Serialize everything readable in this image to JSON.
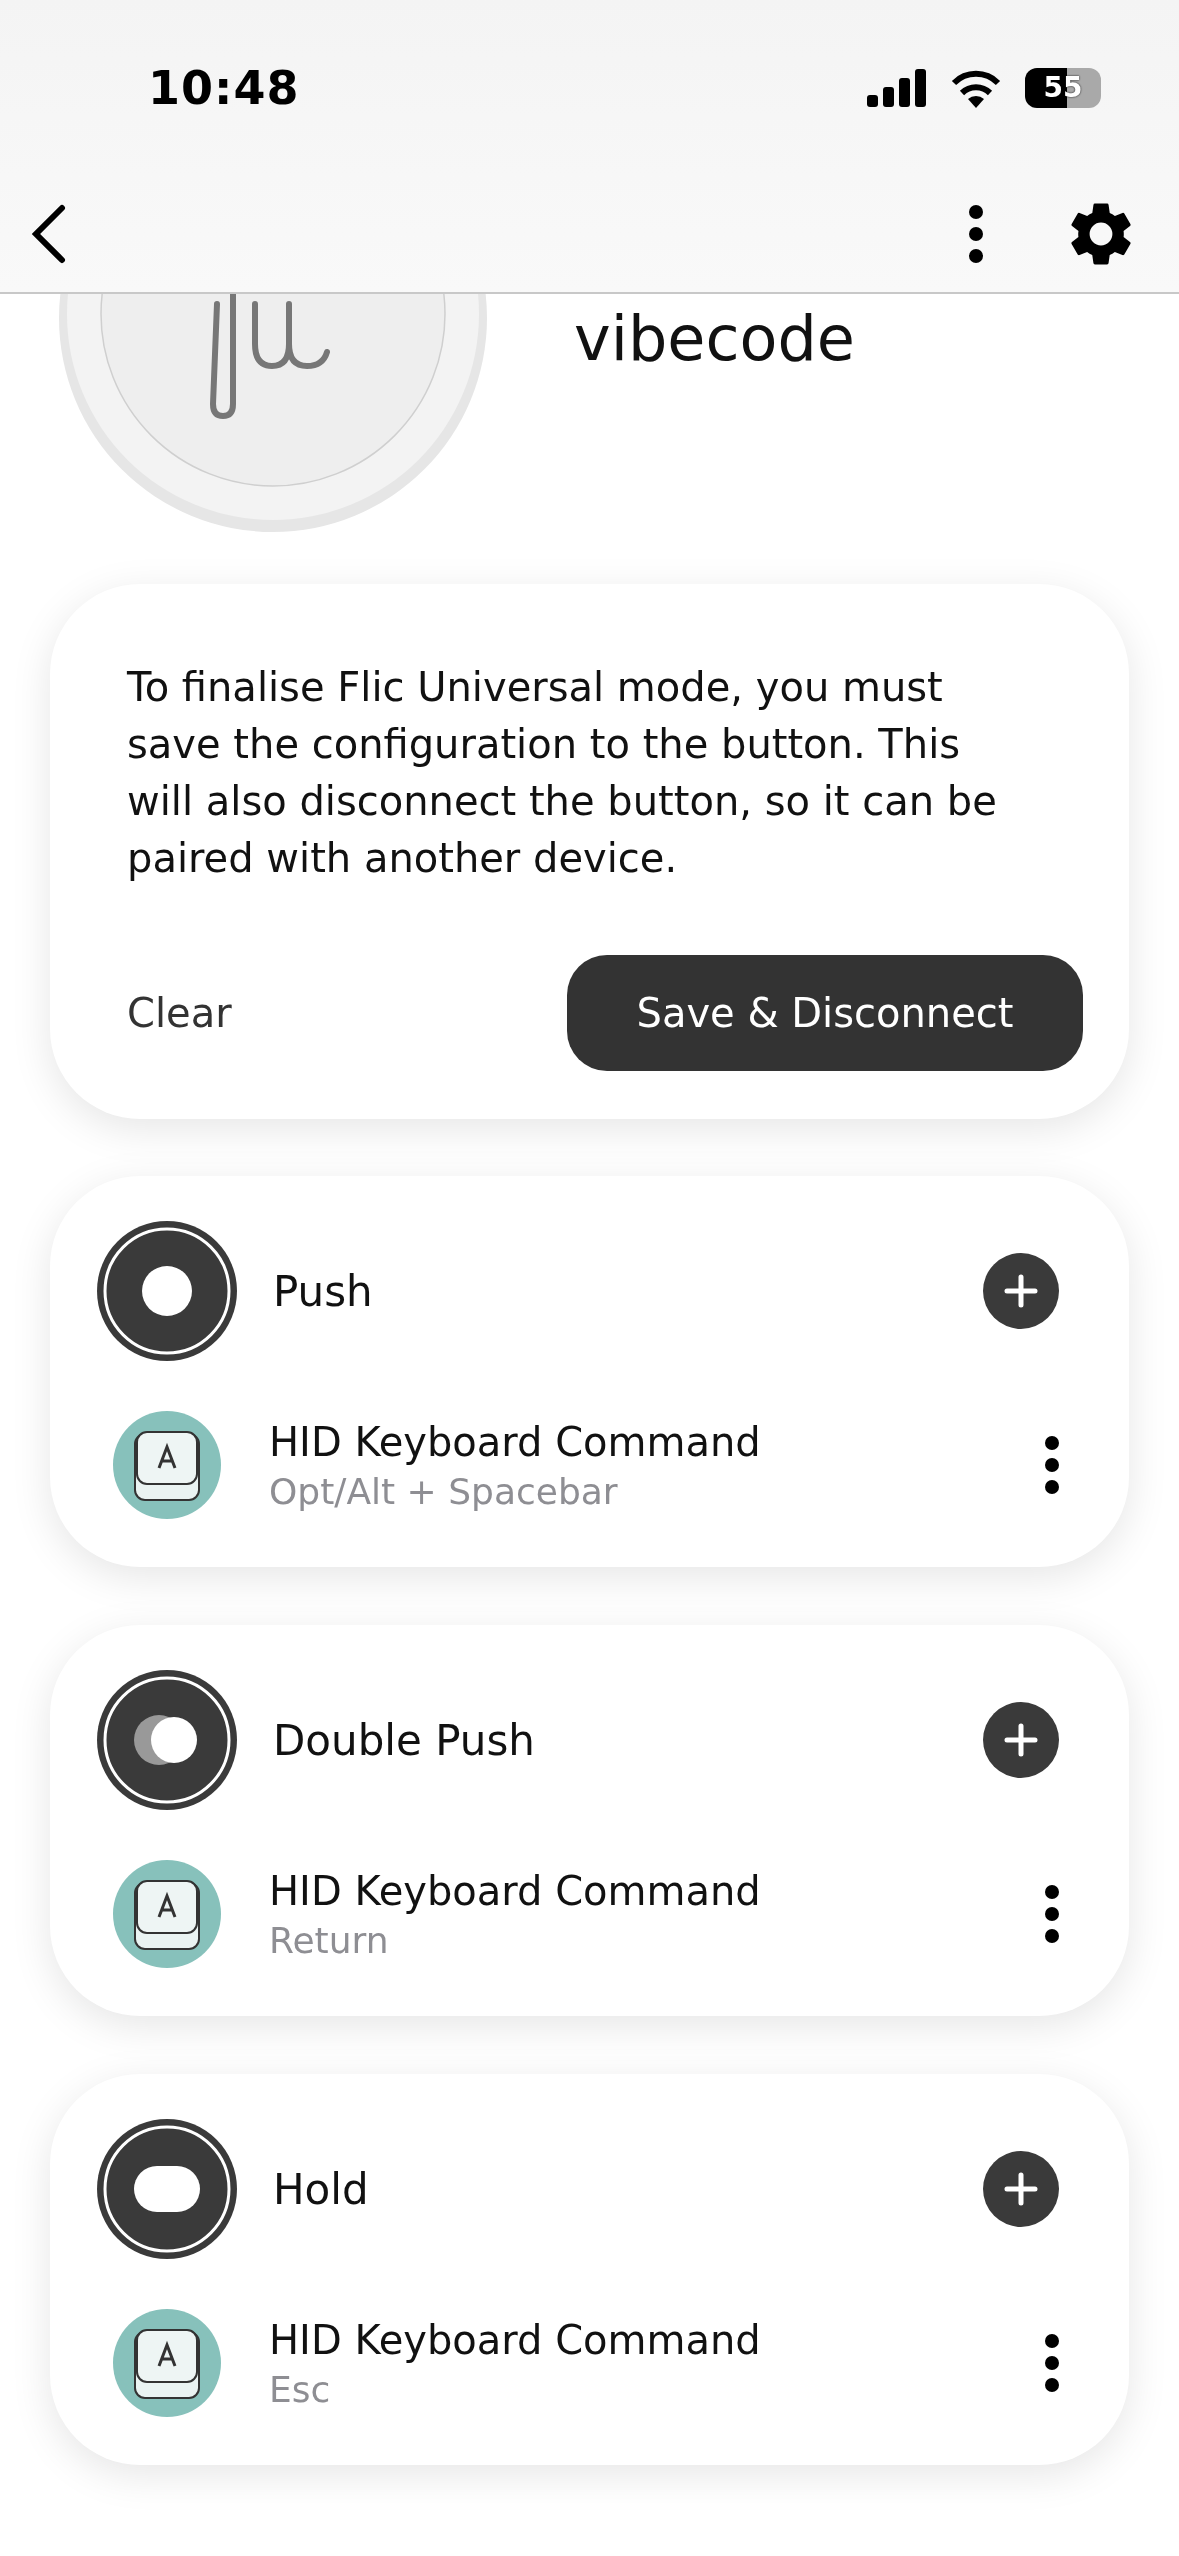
{
  "status_bar": {
    "time": "10:48",
    "battery": "55"
  },
  "device": {
    "name": "vibecode"
  },
  "notice": {
    "text": "To finalise Flic Universal mode, you must save the configuration to the button. This will also disconnect the button, so it can be paired with another device.",
    "secondary_button": "Clear",
    "primary_button": "Save & Disconnect"
  },
  "triggers": [
    {
      "kind": "push",
      "label": "Push",
      "actions": [
        {
          "title": "HID Keyboard Command",
          "detail": "Opt/Alt + Spacebar"
        }
      ]
    },
    {
      "kind": "double_push",
      "label": "Double Push",
      "actions": [
        {
          "title": "HID Keyboard Command",
          "detail": "Return"
        }
      ]
    },
    {
      "kind": "hold",
      "label": "Hold",
      "actions": [
        {
          "title": "HID Keyboard Command",
          "detail": "Esc"
        }
      ]
    }
  ]
}
